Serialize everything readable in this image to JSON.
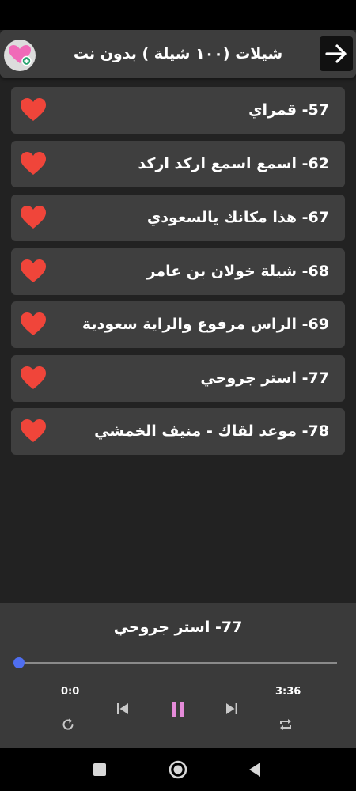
{
  "app": {
    "title": "شيلات (١٠٠ شيلة ) بدون نت",
    "colors": {
      "heart": "#f0453a",
      "accent": "#4f6ef0",
      "pause": "#e58bd9"
    }
  },
  "icons": {
    "favorites": "heart-plus-icon",
    "back": "arrow-right-icon",
    "item": "heart-icon"
  },
  "list": {
    "items": [
      {
        "label": "57- قمراي"
      },
      {
        "label": "62- اسمع اسمع اركد اركد"
      },
      {
        "label": "67- هذا مكانك يالسعودي"
      },
      {
        "label": "68- شيلة خولان بن عامر"
      },
      {
        "label": "69- الراس مرفوع والراية سعودية"
      },
      {
        "label": "77- استر جروحي"
      },
      {
        "label": "78- موعد لقاك - منيف الخمشي"
      }
    ]
  },
  "player": {
    "now_playing": "77- استر جروحي",
    "current_time": "0:0",
    "total_time": "3:36",
    "progress_fraction": 0
  }
}
